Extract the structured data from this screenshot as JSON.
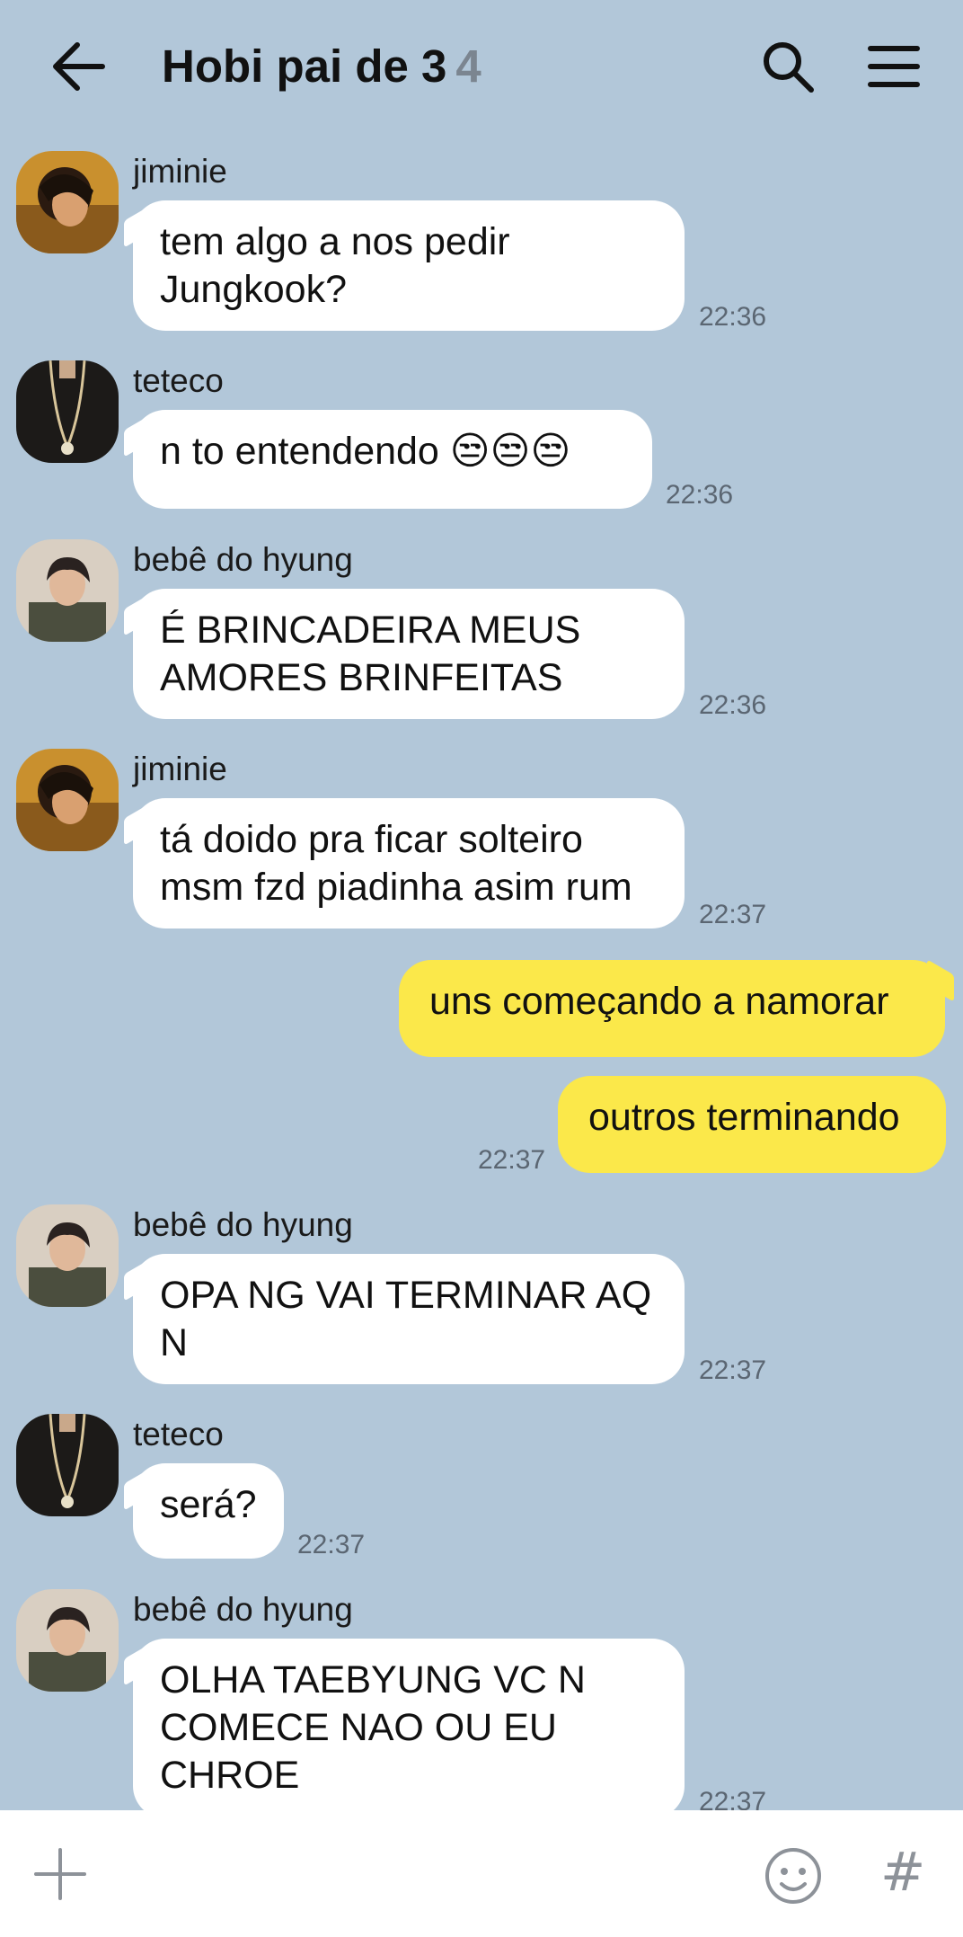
{
  "header": {
    "title": "Hobi pai de 3",
    "member_count": "4"
  },
  "messages": [
    {
      "sender": "jiminie",
      "text": "tem algo a nos pedir\nJungkook?",
      "time": "22:36"
    },
    {
      "sender": "teteco",
      "text": "n to entendendo 😒😒😒",
      "time": "22:36"
    },
    {
      "sender": "bebê do hyung",
      "text": "É BRINCADEIRA MEUS\nAMORES BRINFEITAS",
      "time": "22:36"
    },
    {
      "sender": "jiminie",
      "text": "tá doido pra ficar solteiro\nmsm fzd piadinha asim rum",
      "time": "22:37"
    },
    {
      "text": "uns começando a namorar"
    },
    {
      "text": "outros terminando",
      "time": "22:37"
    },
    {
      "sender": "bebê do hyung",
      "text": "OPA NG VAI TERMINAR AQ\nN",
      "time": "22:37"
    },
    {
      "sender": "teteco",
      "text": "será?",
      "time": "22:37"
    },
    {
      "sender": "bebê do hyung",
      "text": "OLHA TAEBYUNG VC N\nCOMECE NAO OU EU\nCHROE",
      "time": "22:37"
    }
  ],
  "colors": {
    "background": "#b2c7d9",
    "incoming_bubble": "#ffffff",
    "outgoing_bubble": "#fbe84a"
  },
  "icons": {
    "back": "arrow-left-icon",
    "search": "search-icon",
    "menu": "menu-icon",
    "attach": "plus-icon",
    "emoji": "smiley-icon",
    "hashtag": "hash-icon"
  },
  "composer": {
    "hashtag_glyph": "#"
  }
}
